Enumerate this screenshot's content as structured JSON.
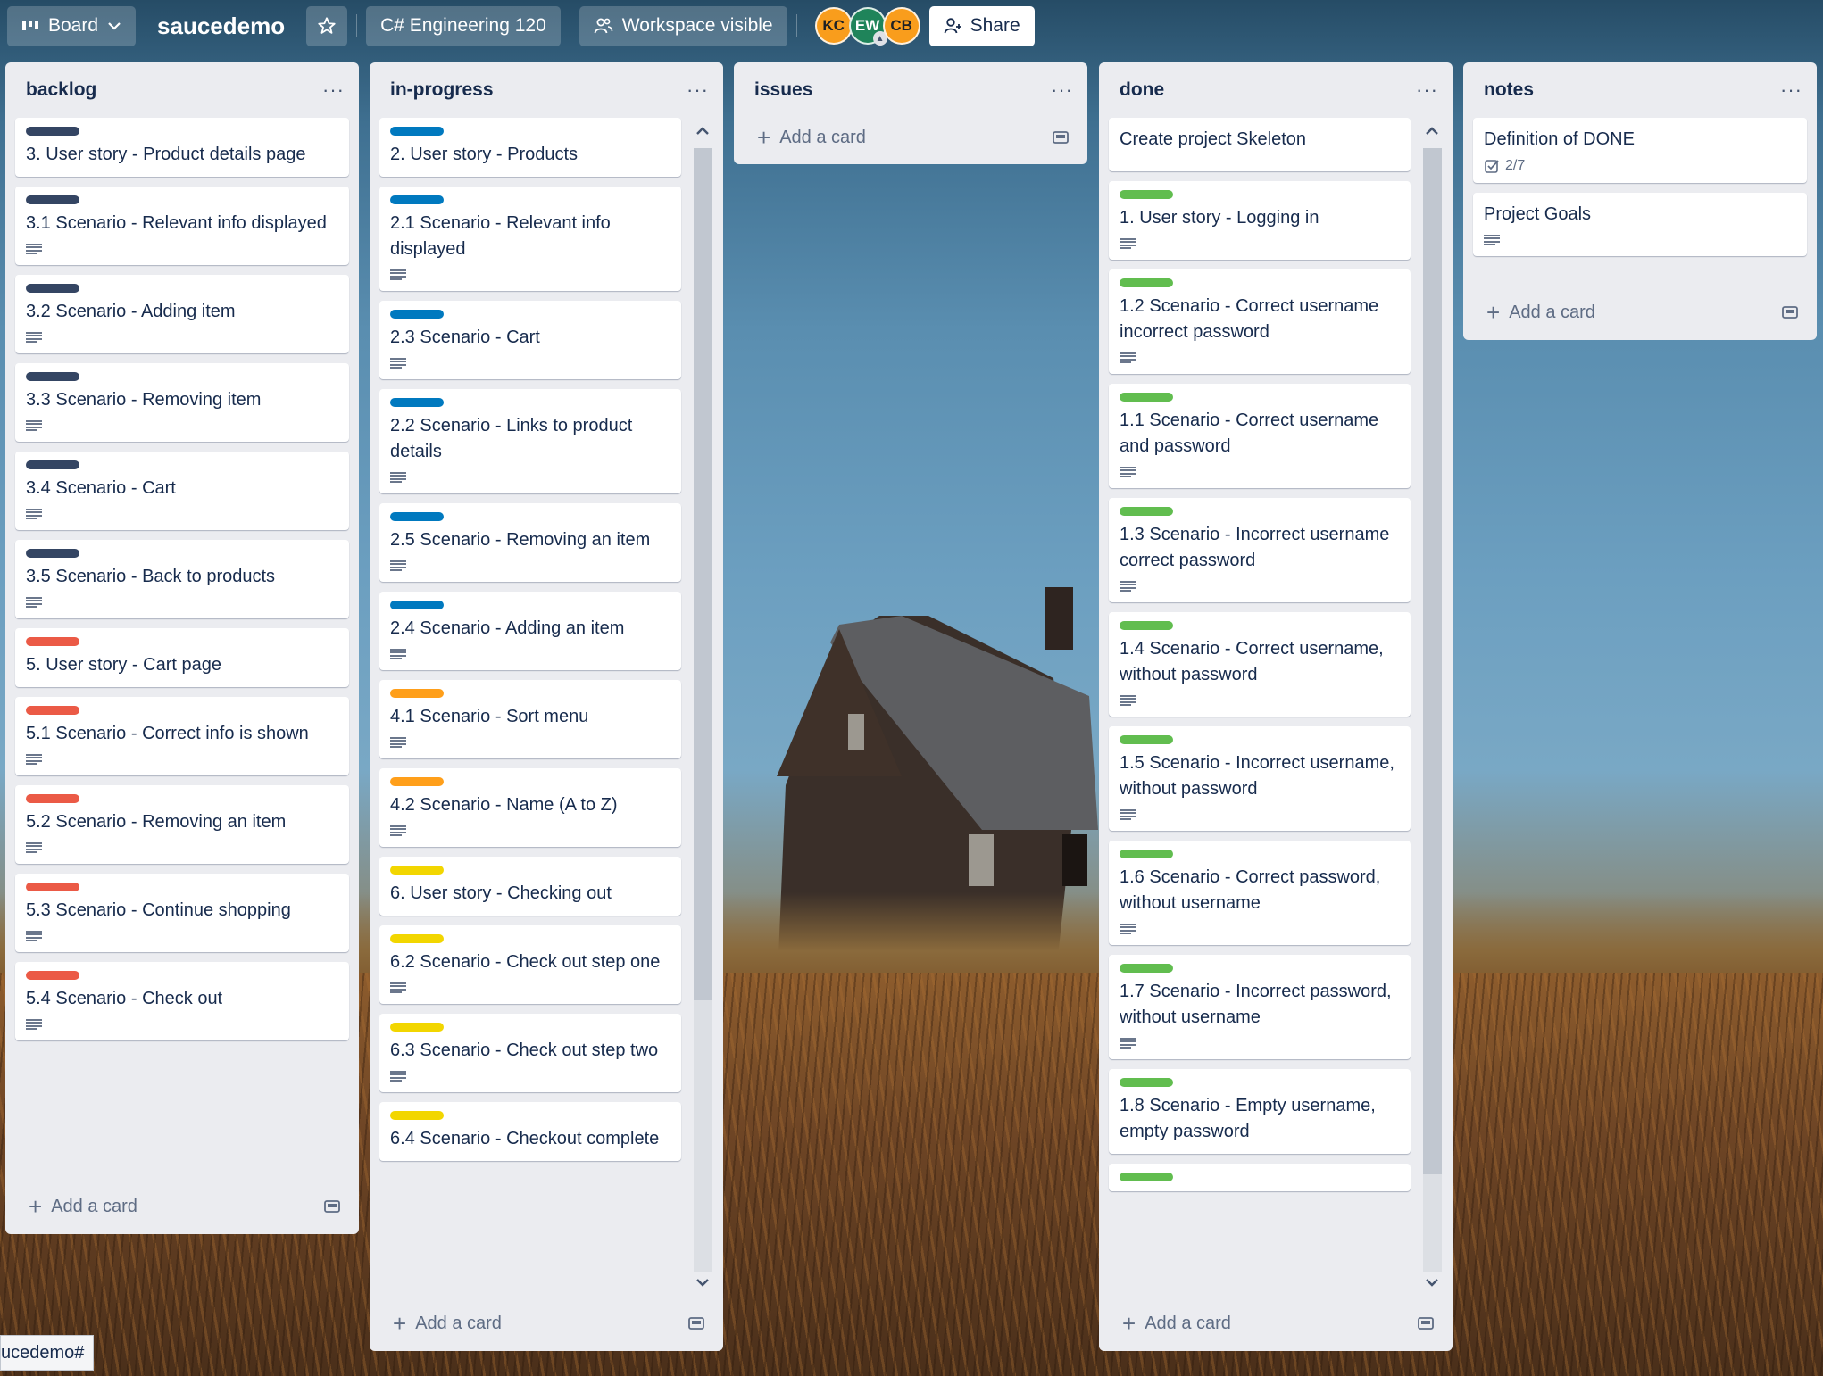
{
  "topbar": {
    "view_label": "Board",
    "board_name": "saucedemo",
    "workspace": "C# Engineering 120",
    "visibility": "Workspace visible",
    "share_label": "Share",
    "members": [
      {
        "initials": "KC",
        "color": "#f99d1c"
      },
      {
        "initials": "EW",
        "color": "#1f845a"
      },
      {
        "initials": "CB",
        "color": "#f99d1c"
      }
    ]
  },
  "colors": {
    "navy": "#344563",
    "blue": "#0079bf",
    "red": "#eb5a46",
    "orange": "#ff9f1a",
    "yellow": "#f2d600",
    "green": "#61bd4f"
  },
  "lists": {
    "backlog": {
      "title": "backlog",
      "menu": "···",
      "add_card": "Add a card",
      "cards": [
        {
          "title": "3. User story - Product details page",
          "label": "#344563",
          "desc": false
        },
        {
          "title": "3.1 Scenario - Relevant info displayed",
          "label": "#344563",
          "desc": true
        },
        {
          "title": "3.2 Scenario - Adding item",
          "label": "#344563",
          "desc": true
        },
        {
          "title": "3.3 Scenario - Removing item",
          "label": "#344563",
          "desc": true
        },
        {
          "title": "3.4 Scenario - Cart",
          "label": "#344563",
          "desc": true
        },
        {
          "title": "3.5 Scenario - Back to products",
          "label": "#344563",
          "desc": true
        },
        {
          "title": "5. User story - Cart page",
          "label": "#eb5a46",
          "desc": false
        },
        {
          "title": "5.1 Scenario - Correct info is shown",
          "label": "#eb5a46",
          "desc": true
        },
        {
          "title": "5.2 Scenario - Removing an item",
          "label": "#eb5a46",
          "desc": true
        },
        {
          "title": "5.3 Scenario - Continue shopping",
          "label": "#eb5a46",
          "desc": true
        },
        {
          "title": "5.4 Scenario - Check out",
          "label": "#eb5a46",
          "desc": true
        }
      ]
    },
    "inprogress": {
      "title": "in-progress",
      "menu": "···",
      "add_card": "Add a card",
      "cards": [
        {
          "title": "2. User story - Products",
          "label": "#0079bf",
          "desc": false
        },
        {
          "title": "2.1 Scenario - Relevant info displayed",
          "label": "#0079bf",
          "desc": true
        },
        {
          "title": "2.3 Scenario - Cart",
          "label": "#0079bf",
          "desc": true
        },
        {
          "title": "2.2 Scenario - Links to product details",
          "label": "#0079bf",
          "desc": true
        },
        {
          "title": "2.5 Scenario - Removing an item",
          "label": "#0079bf",
          "desc": true
        },
        {
          "title": "2.4 Scenario - Adding an item",
          "label": "#0079bf",
          "desc": true
        },
        {
          "title": "4.1 Scenario - Sort menu",
          "label": "#ff9f1a",
          "desc": true
        },
        {
          "title": "4.2 Scenario - Name (A to Z)",
          "label": "#ff9f1a",
          "desc": true
        },
        {
          "title": "6. User story - Checking out",
          "label": "#f2d600",
          "desc": false
        },
        {
          "title": "6.2 Scenario - Check out step one",
          "label": "#f2d600",
          "desc": true
        },
        {
          "title": "6.3 Scenario - Check out step two",
          "label": "#f2d600",
          "desc": true
        },
        {
          "title": "6.4 Scenario - Checkout complete",
          "label": "#f2d600",
          "desc": false
        }
      ]
    },
    "issues": {
      "title": "issues",
      "menu": "···",
      "add_card": "Add a card",
      "cards": []
    },
    "done": {
      "title": "done",
      "menu": "···",
      "add_card": "Add a card",
      "cards": [
        {
          "title": "Create project Skeleton",
          "label": "",
          "desc": false
        },
        {
          "title": "1. User story - Logging in",
          "label": "#61bd4f",
          "desc": true
        },
        {
          "title": "1.2 Scenario - Correct username incorrect password",
          "label": "#61bd4f",
          "desc": true
        },
        {
          "title": "1.1 Scenario - Correct username and password",
          "label": "#61bd4f",
          "desc": true
        },
        {
          "title": "1.3 Scenario - Incorrect username correct password",
          "label": "#61bd4f",
          "desc": true
        },
        {
          "title": "1.4 Scenario - Correct username, without password",
          "label": "#61bd4f",
          "desc": true
        },
        {
          "title": "1.5 Scenario - Incorrect username, without password",
          "label": "#61bd4f",
          "desc": true
        },
        {
          "title": "1.6 Scenario - Correct password, without username",
          "label": "#61bd4f",
          "desc": true
        },
        {
          "title": "1.7 Scenario - Incorrect password, without username",
          "label": "#61bd4f",
          "desc": true
        },
        {
          "title": "1.8 Scenario - Empty username, empty password",
          "label": "#61bd4f",
          "desc": false
        },
        {
          "title": "",
          "label": "#61bd4f",
          "desc": false
        }
      ]
    },
    "notes": {
      "title": "notes",
      "menu": "···",
      "add_card": "Add a card",
      "cards": [
        {
          "title": "Definition of DONE",
          "label": "",
          "desc": false,
          "checklist": "2/7"
        },
        {
          "title": "Project Goals",
          "label": "",
          "desc": true
        }
      ]
    }
  },
  "statusbar": {
    "text": "ucedemo#"
  }
}
